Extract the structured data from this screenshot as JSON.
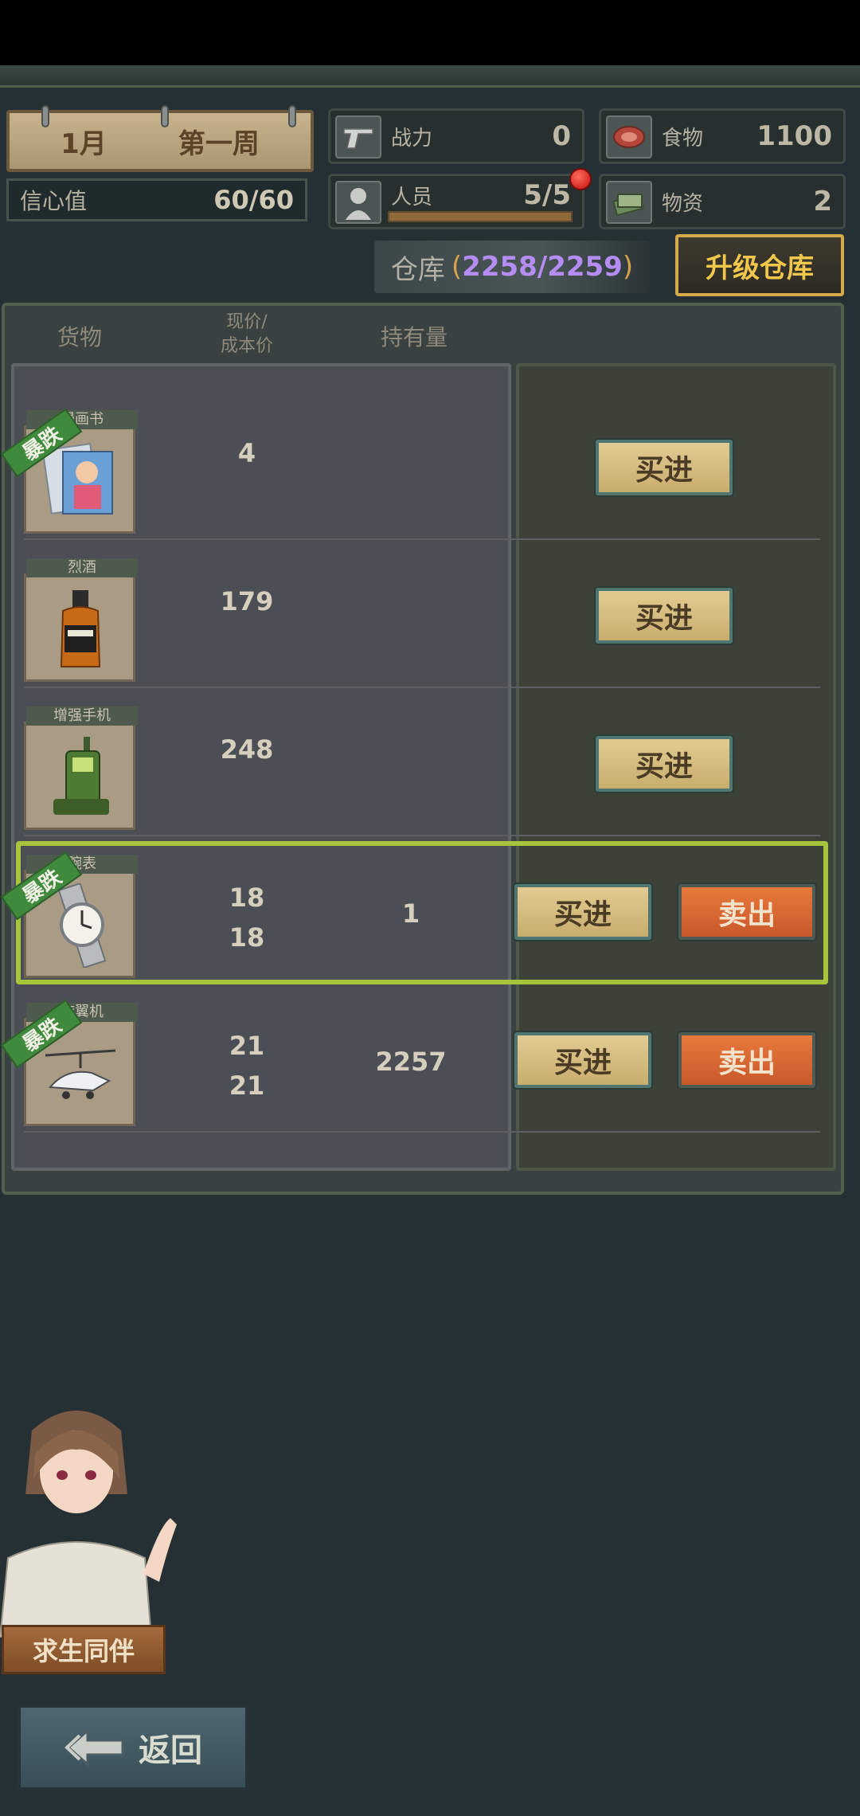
{
  "header": {
    "month": "1月",
    "week": "第一周",
    "confidence_label": "信心值",
    "confidence_value": "60/60",
    "combat_label": "战力",
    "combat_value": "0",
    "food_label": "食物",
    "food_value": "1100",
    "staff_label": "人员",
    "staff_value": "5/5",
    "supplies_label": "物资",
    "supplies_value": "2"
  },
  "warehouse": {
    "label": "仓库",
    "open_paren": "(",
    "capacity": "2258/2259",
    "close_paren": ")",
    "upgrade_label": "升级仓库"
  },
  "columns": {
    "goods": "货物",
    "price_line1": "现价/",
    "price_line2": "成本价",
    "holding": "持有量"
  },
  "items": [
    {
      "name": "漫画书",
      "tag": "暴跌",
      "price": "4",
      "cost": "",
      "holding": "",
      "buy": "买进",
      "sell": ""
    },
    {
      "name": "烈酒",
      "tag": "",
      "price": "179",
      "cost": "",
      "holding": "",
      "buy": "买进",
      "sell": ""
    },
    {
      "name": "增强手机",
      "tag": "",
      "price": "248",
      "cost": "",
      "holding": "",
      "buy": "买进",
      "sell": ""
    },
    {
      "name": "腕表",
      "tag": "暴跌",
      "price": "18",
      "cost": "18",
      "holding": "1",
      "buy": "买进",
      "sell": "卖出"
    },
    {
      "name": "旋翼机",
      "tag": "暴跌",
      "price": "21",
      "cost": "21",
      "holding": "2257",
      "buy": "买进",
      "sell": "卖出"
    }
  ],
  "companion": {
    "label": "求生同伴"
  },
  "back": {
    "label": "返回"
  }
}
